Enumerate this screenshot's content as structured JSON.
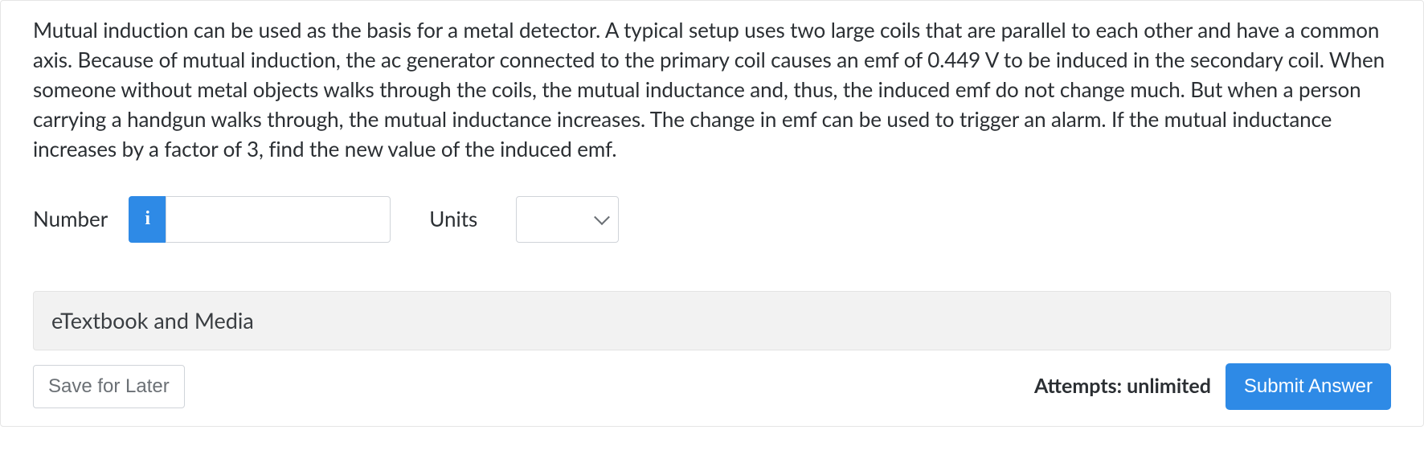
{
  "question": {
    "text": "Mutual induction can be used as the basis for a metal detector. A typical setup uses two large coils that are parallel to each other and have a common axis. Because of mutual induction, the ac generator connected to the primary coil causes an emf of 0.449 V to be induced in the secondary coil. When someone without metal objects walks through the coils, the mutual inductance and, thus, the induced emf do not change much. But when a person carrying a handgun walks through, the mutual inductance increases. The change in emf can be used to trigger an alarm. If the mutual inductance increases by a factor of 3, find the new value of the induced emf."
  },
  "answer": {
    "number_label": "Number",
    "info_icon": "i",
    "number_value": "",
    "units_label": "Units",
    "units_value": ""
  },
  "resources": {
    "etextbook_label": "eTextbook and Media"
  },
  "footer": {
    "save_label": "Save for Later",
    "attempts_label": "Attempts: unlimited",
    "submit_label": "Submit Answer"
  }
}
